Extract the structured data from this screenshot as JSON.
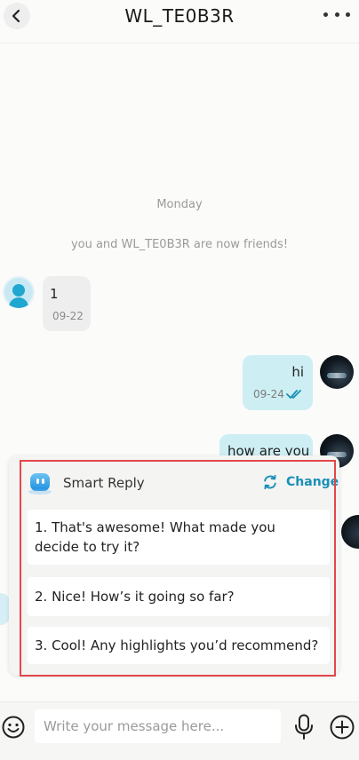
{
  "header": {
    "title": "WL_TE0B3R"
  },
  "chat": {
    "day_label": "Monday",
    "friends_notice": "you and WL_TE0B3R are now friends!",
    "messages": [
      {
        "direction": "in",
        "text": "1",
        "time": "09-22"
      },
      {
        "direction": "out",
        "text": "hi",
        "time": "09-24",
        "status": "read"
      },
      {
        "direction": "out",
        "text": "how are you"
      }
    ]
  },
  "smart_reply": {
    "title": "Smart Reply",
    "change_label": "Change",
    "options": [
      "1. That's awesome! What made you decide to try it?",
      "2. Nice! How’s it going so far?",
      "3. Cool! Any highlights you’d recommend?"
    ]
  },
  "composer": {
    "placeholder": "Write your message here...",
    "value": ""
  },
  "colors": {
    "accent": "#1a8fb8",
    "outgoing_bubble": "#cdeef3",
    "incoming_bubble": "#eeeeee",
    "highlight_border": "#e2474b"
  },
  "icons": {
    "back": "chevron-left-icon",
    "more": "more-dots-icon",
    "check": "double-check-icon",
    "change": "refresh-icon",
    "emoji": "emoji-icon",
    "mic": "microphone-icon",
    "add": "plus-circle-icon",
    "smart_reply": "robot-icon"
  }
}
